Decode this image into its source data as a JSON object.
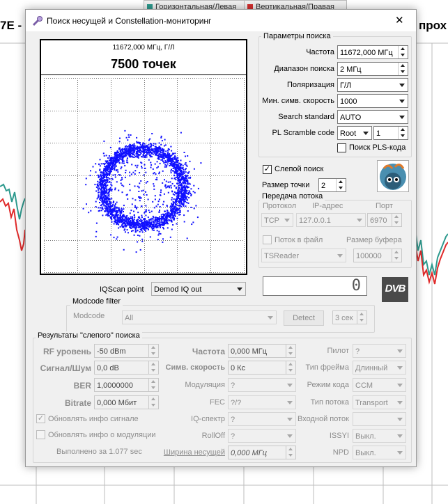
{
  "background": {
    "tab_left": "Горизонтальная/Левая",
    "tab_right": "Вертикальная/Правая",
    "left_title_fragment": "7E -",
    "right_title_fragment": "прох",
    "colors": {
      "teal": "#2e9a8e",
      "red": "#e02a2a",
      "tab_green": "#2e9a8e",
      "tab_red": "#d32f2f"
    }
  },
  "dialog": {
    "title": "Поиск несущей и Constellation-мониторинг",
    "close_glyph": "✕"
  },
  "constellation": {
    "header_freq": "11672,000 МГц, Г/Л",
    "header_points": "7500 точек",
    "dot_color": "#1010ff"
  },
  "search_params": {
    "title": "Параметры поиска",
    "frequency": {
      "label": "Частота",
      "value": "11672,000 МГц"
    },
    "range": {
      "label": "Диапазон поиска",
      "value": "2 МГц"
    },
    "polarization": {
      "label": "Поляризация",
      "value": "Г/Л"
    },
    "min_symbol_rate": {
      "label": "Мин. симв. скорость",
      "value": "1000"
    },
    "search_standard": {
      "label": "Search standard",
      "value": "AUTO"
    },
    "pl_scramble": {
      "label": "PL Scramble code",
      "type_value": "Root",
      "code_value": "1"
    },
    "pls_search": {
      "label": "Поиск PLS-кода",
      "checked": false
    }
  },
  "blind": {
    "label": "Слепой поиск",
    "checked": true,
    "point_size_label": "Размер точки",
    "point_size_value": "2"
  },
  "stream": {
    "title": "Передача потока",
    "protocol_label": "Протокол",
    "ip_label": "IP-адрес",
    "port_label": "Порт",
    "protocol_value": "TCP",
    "ip_value": "127.0.0.1",
    "port_value": "6970",
    "to_file_label": "Поток в файл",
    "buffer_label": "Размер буфера",
    "reader_value": "TSReader",
    "buffer_value": "100000"
  },
  "iqscan": {
    "label": "IQScan point",
    "value": "Demod IQ out"
  },
  "counter": {
    "value": "0"
  },
  "dvb_logo": "DVB",
  "modcode": {
    "title": "Modcode filter",
    "label": "Modcode",
    "value": "All",
    "detect": "Detect",
    "seconds": "3 сек"
  },
  "results": {
    "title": "Результаты \"слепого\" поиска",
    "rf_label": "RF уровень",
    "rf_value": "-50 dBm",
    "snr_label": "Сигнал/Шум",
    "snr_value": "0,0 dB",
    "ber_label": "BER",
    "ber_value": "1,0000000",
    "bitrate_label": "Bitrate",
    "bitrate_value": "0,000 Мбит",
    "freq_label": "Частота",
    "freq_value": "0,000 МГц",
    "symrate_label": "Симв. скорость",
    "symrate_value": "0 Кс",
    "modulation_label": "Модуляция",
    "modulation_value": "?",
    "fec_label": "FEC",
    "fec_value": "?/?",
    "iq_label": "IQ-спектр",
    "iq_value": "?",
    "rolloff_label": "RollOff",
    "rolloff_value": "?",
    "bandwidth_label": "Ширина несущей",
    "bandwidth_value": "0,000 МГц",
    "pilot_label": "Пилот",
    "pilot_value": "?",
    "frame_label": "Тип фрейма",
    "frame_value": "Длинный",
    "codemode_label": "Режим кода",
    "codemode_value": "CCM",
    "streamtype_label": "Тип потока",
    "streamtype_value": "Transport",
    "input_label": "Входной поток",
    "input_value": "",
    "issyi_label": "ISSYI",
    "issyi_value": "Выкл.",
    "npd_label": "NPD",
    "npd_value": "Выкл.",
    "update_signal": "Обновлять инфо сигнале",
    "update_modulation": "Обновлять инфо о модуляции",
    "elapsed": "Выполнено за 1.077 sec"
  }
}
